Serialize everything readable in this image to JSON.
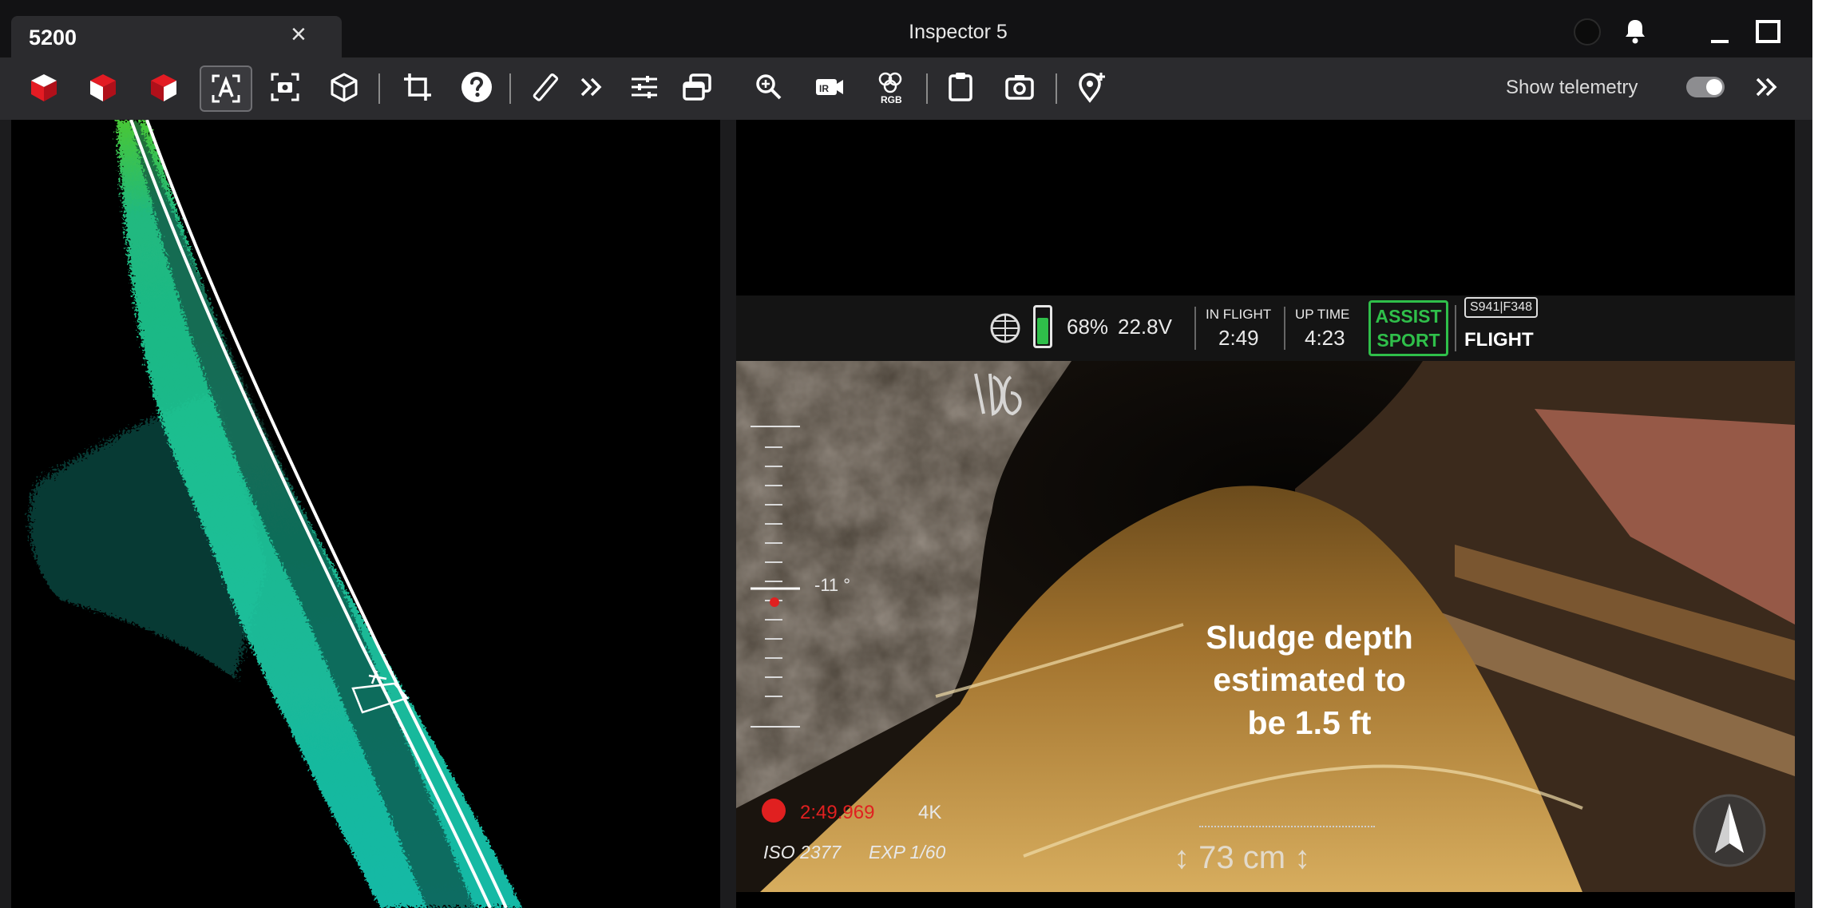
{
  "window": {
    "tab_title": "5200",
    "app_title": "Inspector 5"
  },
  "toolbar": {
    "show_telemetry_label": "Show telemetry",
    "show_telemetry_on": true
  },
  "hud": {
    "battery_percent": "68%",
    "battery_level": 0.68,
    "voltage": "22.8V",
    "in_flight_label": "IN FLIGHT",
    "in_flight_time": "2:49",
    "up_time_label": "UP TIME",
    "up_time": "4:23",
    "mode_assist": "ASSIST",
    "mode_sport": "SPORT",
    "aircraft_id": "S941|F348",
    "flight_label": "FLIGHT"
  },
  "video_overlay": {
    "wall_marking": "105",
    "pitch": "-11 °",
    "record_time": "2:49.969",
    "resolution": "4K",
    "iso": "ISO 2377",
    "exposure": "EXP 1/60",
    "distance": "↕ 73 cm ↕"
  },
  "annotation": {
    "line1": "Sludge depth",
    "line2": "estimated to",
    "line3": "be 1.5 ft"
  },
  "colors": {
    "accent_green": "#2fbf4a",
    "record_red": "#e02020",
    "cloud_teal": "#1fd4b0"
  }
}
